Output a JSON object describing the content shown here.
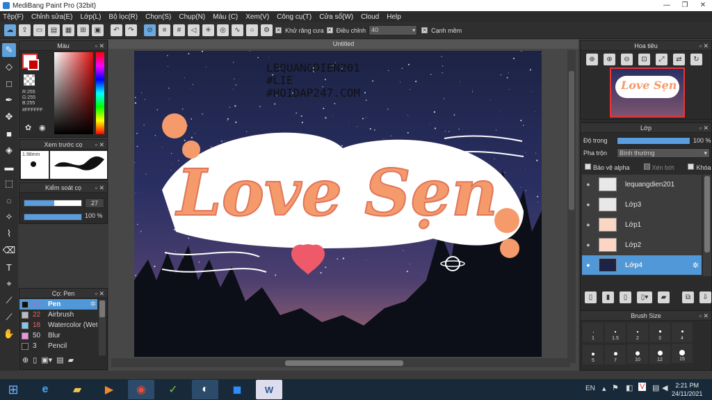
{
  "window": {
    "title": "MediBang Paint Pro (32bit)",
    "min": "—",
    "max": "❐",
    "close": "✕"
  },
  "menu": [
    "Tệp(F)",
    "Chỉnh sửa(E)",
    "Lớp(L)",
    "Bộ lọc(R)",
    "Chọn(S)",
    "Chụp(N)",
    "Màu (C)",
    "Xem(V)",
    "Công cụ(T)",
    "Cửa sổ(W)",
    "Cloud",
    "Help"
  ],
  "toolbar": {
    "antialias_label": "Khử răng cưa",
    "adjust_label": "Điều chỉnh",
    "adjust_value": "40",
    "smooth_label": "Cạnh mềm"
  },
  "color_panel": {
    "title": "Màu",
    "r": "R:255",
    "g": "G:255",
    "b": "B:255",
    "hex": "#FFFFFF"
  },
  "brush_preview": {
    "title": "Xem trước cọ",
    "size": "1.98mm"
  },
  "brush_control": {
    "title": "Kiểm soát cọ",
    "size": "27",
    "opacity": "100 %"
  },
  "brush_list": {
    "title": "Cọ: Pen",
    "items": [
      {
        "size": "27",
        "name": "Pen",
        "color": "#111111"
      },
      {
        "size": "22",
        "name": "Airbrush",
        "color": "#bbbbbb"
      },
      {
        "size": "18",
        "name": "Watercolor (Wet",
        "color": "#7ec9ef"
      },
      {
        "size": "50",
        "name": "Blur",
        "color": "#f090e0"
      },
      {
        "size": "3",
        "name": "Pencil",
        "color": "#222222"
      }
    ]
  },
  "document": {
    "tab": "Untitled"
  },
  "artwork": {
    "text_lines": [
      "LEQUANGDIEN201",
      "#LIE",
      "#HOIDAP247.COM"
    ],
    "lettering": "Love Sẹn"
  },
  "navigator": {
    "title": "Hoa tiêu"
  },
  "layers_panel": {
    "title": "Lớp",
    "opacity_label": "Độ trong",
    "opacity_value": "100 %",
    "blend_label": "Pha trộn",
    "blend_value": "Bình thường",
    "protect_alpha": "Bảo vệ alpha",
    "clip": "Xén bớt",
    "lock": "Khóa",
    "layers": [
      {
        "name": "lequangdien201",
        "selected": false
      },
      {
        "name": "Lớp3",
        "selected": false
      },
      {
        "name": "Lớp1",
        "selected": false
      },
      {
        "name": "Lớp2",
        "selected": false
      },
      {
        "name": "Lớp4",
        "selected": true
      }
    ]
  },
  "brush_size_panel": {
    "title": "Brush Size",
    "sizes_row1": [
      "1",
      "1.5",
      "2",
      "3",
      "4"
    ],
    "sizes_row2": [
      "5",
      "7",
      "10",
      "12",
      "15"
    ]
  },
  "taskbar": {
    "lang": "EN",
    "time": "2:21 PM",
    "date": "24/11/2021"
  },
  "colors": {
    "accent": "#5198d8",
    "panel": "#2b2b2b",
    "lettering": "#f59a6b",
    "heart": "#ef5a6a"
  }
}
